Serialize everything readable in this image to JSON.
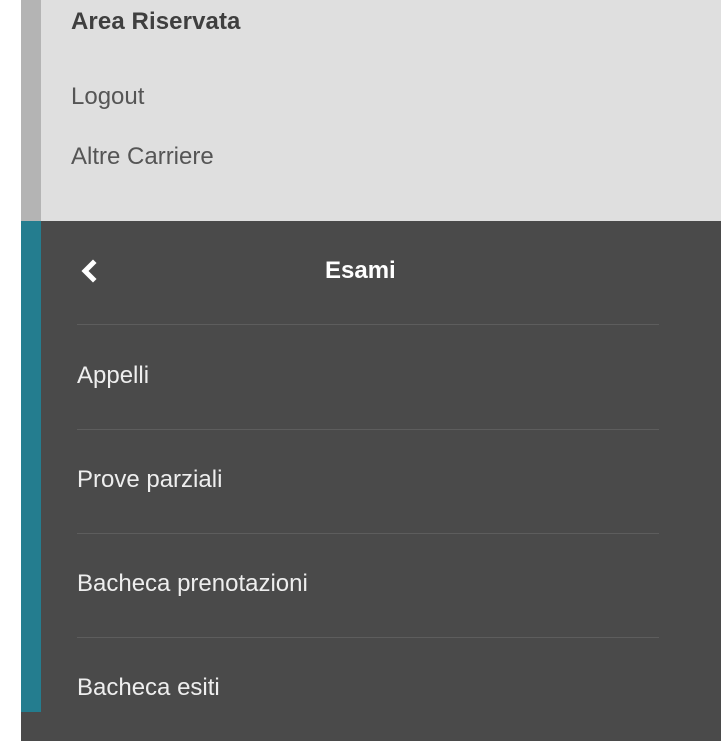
{
  "top_area": {
    "title": "Area Riservata",
    "links": [
      {
        "label": "Logout"
      },
      {
        "label": "Altre Carriere"
      }
    ]
  },
  "menu": {
    "back_icon": "chevron-left-icon",
    "title": "Esami",
    "items": [
      {
        "label": "Appelli"
      },
      {
        "label": "Prove parziali"
      },
      {
        "label": "Bacheca prenotazioni"
      },
      {
        "label": "Bacheca esiti"
      }
    ]
  },
  "colors": {
    "top_background": "#dfdfdf",
    "top_accent": "#b4b4b4",
    "menu_background": "#4a4a4a",
    "menu_accent": "#247d8f",
    "divider": "#5d5d5d"
  }
}
